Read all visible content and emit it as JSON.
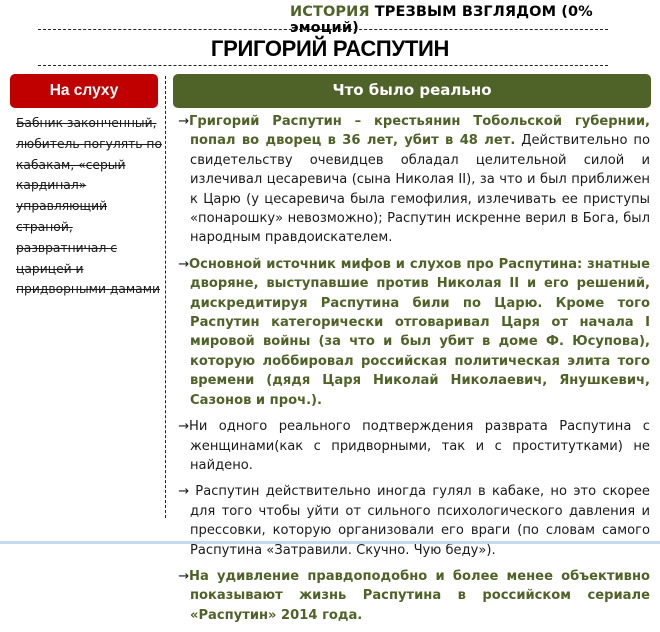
{
  "header": {
    "tagline_accent": "ИСТОРИЯ",
    "tagline_rest": " ТРЕЗВЫМ  ВЗГЛЯДОМ  (0% эмоций)",
    "title": "ГРИГОРИЙ РАСПУТИН"
  },
  "columns": {
    "left_label": "На слуху",
    "right_label": "Что было реально"
  },
  "rumor_text": "Бабник законченный, любитель погулять по кабакам, «серый кардинал» управляющий страной, развратничал с царицей и придворными дамами",
  "facts": [
    {
      "arrow": "→",
      "bold": "Григорий Распутин – крестьянин Тобольской губернии, попал во дворец в 36 лет, убит в 48 лет.",
      "text": " Действительно по свидетельству очевидцев обладал целительной силой и излечивал цесаревича (сына Николая II), за что и был приближен к Царю (у цесаревича была гемофилия, излечивать ее приступы «понарошку» невозможно); Распутин искренне верил в Бога, был народным правдоискателем."
    },
    {
      "arrow": "→",
      "bold": "Основной источник мифов и слухов про Распутина: знатные дворяне, выступавшие против Николая II и его решений, дискредитируя Распутина били по Царю. Кроме того Распутин категорически отговаривал Царя от начала I мировой войны (за что и был убит в доме Ф. Юсупова), которую лоббировал российская политическая элита того времени (дядя Царя Николай Николаевич, Янушкевич, Сазонов и проч.).",
      "text": ""
    },
    {
      "arrow": "→",
      "bold": "",
      "text": "Ни одного реального подтверждения разврата Распутина с женщинами(как с придворными, так и с проститутками) не найдено."
    },
    {
      "arrow": "→",
      "bold": "",
      "text": " Распутин действительно иногда гулял в кабаке, но это скорее для того чтобы уйти от сильного психологического давления и прессовки, которую организовали его враги (по словам самого Распутина «Затравили. Скучно. Чую беду»)."
    },
    {
      "arrow": "→",
      "bold": "На удивление правдоподобно и более менее объективно показывают жизнь Распутина в российском сериале «Распутин» 2014 года.",
      "text": ""
    }
  ],
  "colors": {
    "accent_green": "#4f6228",
    "rumor_red": "#c00000"
  }
}
